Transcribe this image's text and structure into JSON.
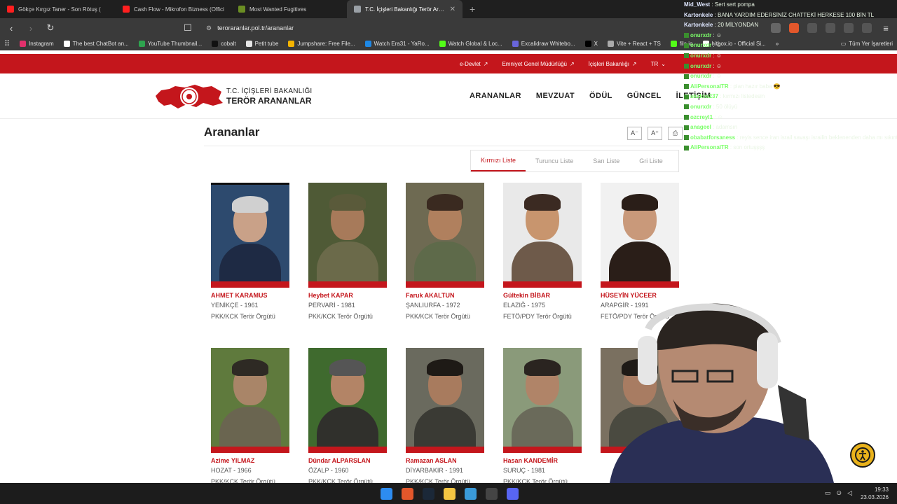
{
  "browser": {
    "tabs": [
      {
        "title": "Gökçe Kırgız Taner - Son Rötuş (",
        "icon_color": "#ff1f1f"
      },
      {
        "title": "Cash Flow - Mikrofon Bizness (Offici",
        "icon_color": "#ff1f1f"
      },
      {
        "title": "Most Wanted Fugitives",
        "icon_color": "#6b8e23"
      },
      {
        "title": "T.C. İçişleri Bakanlığı Terör Aranan",
        "icon_color": "#9aa0a6"
      }
    ],
    "new_tab": "+",
    "url": "teroraranlar.pol.tr/arananlar",
    "bookmarks": [
      {
        "label": "Instagram",
        "color": "#e1306c"
      },
      {
        "label": "The best ChatBot an...",
        "color": "#ffffff"
      },
      {
        "label": "YouTube Thumbnail...",
        "color": "#2ea44f"
      },
      {
        "label": "cobalt",
        "color": "#111111"
      },
      {
        "label": "Petit tube",
        "color": "#e6e6e6"
      },
      {
        "label": "Jumpshare: Free File...",
        "color": "#f4b400"
      },
      {
        "label": "Watch Era31 - YaRo...",
        "color": "#1e88e5"
      },
      {
        "label": "Watch Global & Loc...",
        "color": "#53fc18"
      },
      {
        "label": "Excalidraw Whitebo...",
        "color": "#6965db"
      },
      {
        "label": "X",
        "color": "#000000"
      },
      {
        "label": "Vite + React + TS",
        "color": "#aaaaaa"
      },
      {
        "label": "file.io",
        "color": "#53fc18"
      },
      {
        "label": "hitbox.io - Official Si...",
        "color": "#ffffff"
      }
    ],
    "bookmarks_overflow": "»",
    "all_bookmarks": "Tüm Yer İşaretleri"
  },
  "topbar": {
    "links": [
      "e-Devlet",
      "Emniyet Genel Müdürlüğü",
      "İçişleri Bakanlığı",
      "TR"
    ]
  },
  "header": {
    "logo_line1": "T.C. İÇİŞLERİ BAKANLIĞI",
    "logo_line2": "TERÖR ARANANLAR",
    "nav": [
      "ARANANLAR",
      "MEVZUAT",
      "ÖDÜL",
      "GÜNCEL",
      "İLETİŞİM"
    ]
  },
  "page": {
    "title": "Arananlar",
    "tools": [
      "A⁻",
      "A⁺",
      "⎙"
    ],
    "list_tabs": [
      "Kırmızı Liste",
      "Turuncu Liste",
      "Sarı Liste",
      "Gri Liste"
    ],
    "active_list": "Kırmızı Liste"
  },
  "wanted": [
    {
      "name": "AHMET KARAMUS",
      "info": "YENİKÇE - 1961",
      "org": "PKK/KCK Terör Örgütü",
      "bg": "#2d4a6e",
      "skin": "#c9a188",
      "hair": "#d0d0d0",
      "cloth": "#1e2a44"
    },
    {
      "name": "Heybet KAPAR",
      "info": "PERVARİ - 1981",
      "org": "PKK/KCK Terör Örgütü",
      "bg": "#4f5a36",
      "skin": "#a77a5a",
      "hair": "#5a5a3a",
      "cloth": "#6b6a4a"
    },
    {
      "name": "Faruk AKALTUN",
      "info": "ŞANLIURFA - 1972",
      "org": "PKK/KCK Terör Örgütü",
      "bg": "#6e6a52",
      "skin": "#b0805e",
      "hair": "#3a2a20",
      "cloth": "#5e6a4a"
    },
    {
      "name": "Gültekin BİBAR",
      "info": "ELAZIĞ - 1975",
      "org": "FETÖ/PDY Terör Örgütü",
      "bg": "#e9e9e9",
      "skin": "#c8956e",
      "hair": "#3b2a22",
      "cloth": "#6e5a4a"
    },
    {
      "name": "HÜSEYİN YÜCEER",
      "info": "ARAPGİR - 1991",
      "org": "FETÖ/PDY Terör Örgütü",
      "bg": "#f1f1f1",
      "skin": "#c9997a",
      "hair": "#2a1e18",
      "cloth": "#2a1e18"
    },
    {
      "name": "Azime YILMAZ",
      "info": "HOZAT - 1966",
      "org": "PKK/KCK Terör Örgütü",
      "bg": "#5f7a3d",
      "skin": "#a98568",
      "hair": "#2e2a24",
      "cloth": "#6a6550"
    },
    {
      "name": "Dündar ALPARSLAN",
      "info": "ÖZALP - 1960",
      "org": "PKK/KCK Terör Örgütü",
      "bg": "#3f6a2e",
      "skin": "#b38466",
      "hair": "#555555",
      "cloth": "#30302c"
    },
    {
      "name": "Ramazan ASLAN",
      "info": "DİYARBAKIR - 1991",
      "org": "PKK/KCK Terör Örgütü",
      "bg": "#6a6a5e",
      "skin": "#a87b5e",
      "hair": "#1e1a16",
      "cloth": "#3a3a34"
    },
    {
      "name": "Hasan KANDEMİR",
      "info": "SURUÇ - 1981",
      "org": "PKK/KCK Terör Örgütü",
      "bg": "#8a9a7a",
      "skin": "#b08468",
      "hair": "#2a2420",
      "cloth": "#6a6a5a"
    },
    {
      "name": "",
      "info": "",
      "org": "",
      "bg": "#7a7060",
      "skin": "#a87c62",
      "hair": "#1e1a16",
      "cloth": "#4a4a40"
    }
  ],
  "chat": [
    {
      "user": "Mid_West",
      "text": "Sert sert pompa",
      "white": true
    },
    {
      "user": "Kartonkele",
      "text": "BANA YARDIM EDERSİNİZ CHATTEKİ HERKESE 100 BİN TL",
      "white": true
    },
    {
      "user": "Kartonkele",
      "text": "20 MİLYONDAN",
      "white": true
    },
    {
      "user": "onurxdr",
      "text": "☺",
      "white": false
    },
    {
      "user": "onurxdr",
      "text": "☺",
      "white": false
    },
    {
      "user": "onurxdr",
      "text": "☺",
      "white": false
    },
    {
      "user": "onurxdr",
      "text": "☺",
      "white": false
    },
    {
      "user": "onurxdr",
      "text": "☺",
      "white": false
    },
    {
      "user": "AliPersonalTR",
      "text": "plan hazır baba 😎",
      "white": false
    },
    {
      "user": "ukzlow237",
      "text": "kırmızı listedesin",
      "white": false
    },
    {
      "user": "onurxdr",
      "text": "50 ölüyü",
      "white": false
    },
    {
      "user": "ozcreyl1",
      "text": "☺",
      "white": false
    },
    {
      "user": "anageel",
      "text": "adamsın",
      "white": false
    },
    {
      "user": "obabatforsaness",
      "text": "reyis sence iran israil savaşı israilin beklenenden daha mı sıkıntılı geçiyor",
      "white": false
    },
    {
      "user": "AliPersonalTR",
      "text": "son ortuşşşş",
      "white": false
    }
  ],
  "taskbar": {
    "time": "19:33",
    "date": "23.03.2026",
    "apps": [
      "windows",
      "brave",
      "steam",
      "files",
      "photos",
      "obs",
      "discord"
    ]
  }
}
